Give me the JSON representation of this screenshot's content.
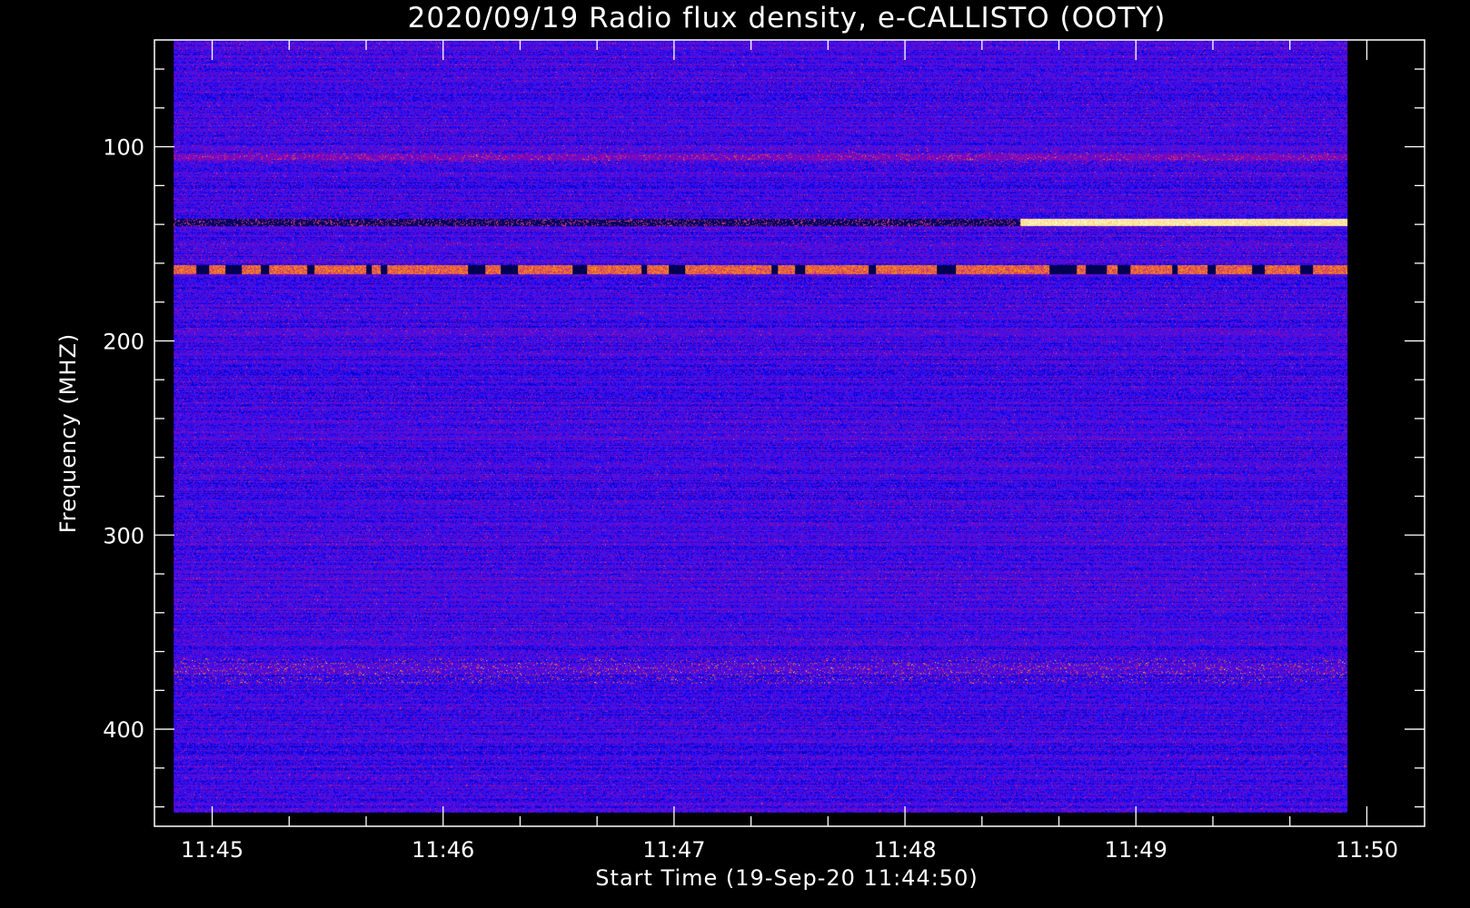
{
  "chart_data": {
    "type": "heatmap",
    "title": "2020/09/19  Radio flux density, e-CALLISTO (OOTY)",
    "xlabel": "Start Time (19-Sep-20 11:44:50)",
    "ylabel": "Frequency (MHZ)",
    "x_ticks": [
      "11:45",
      "11:46",
      "11:47",
      "11:48",
      "11:49",
      "11:50"
    ],
    "y_ticks": [
      "100",
      "200",
      "300",
      "400"
    ],
    "xlim": [
      "11:44:45",
      "11:50:15"
    ],
    "ylim": [
      45,
      450
    ],
    "y_reversed": true,
    "data_extent": {
      "time": [
        "11:44:50",
        "11:49:55"
      ],
      "frequency_mhz": [
        45,
        443
      ]
    },
    "colormap": [
      "#000000",
      "#1e1eff",
      "#ff1e1e",
      "#ffff66",
      "#ffffff"
    ],
    "background_level": "blue noise",
    "features": [
      {
        "frequency_mhz": 105,
        "time": [
          "11:44:50",
          "11:49:55"
        ],
        "level": "moderate red, intermittent dark"
      },
      {
        "frequency_mhz": 139,
        "time": [
          "11:48:30",
          "11:49:55"
        ],
        "level": "intense white-yellow"
      },
      {
        "frequency_mhz": 139,
        "time": [
          "11:44:50",
          "11:48:25"
        ],
        "level": "dark"
      },
      {
        "frequency_mhz": 163,
        "time": [
          "11:44:50",
          "11:49:55"
        ],
        "level": "red band with black gaps"
      },
      {
        "frequency_mhz": 370,
        "time": [
          "11:44:50",
          "11:49:55"
        ],
        "level": "weak red spikes"
      }
    ]
  }
}
